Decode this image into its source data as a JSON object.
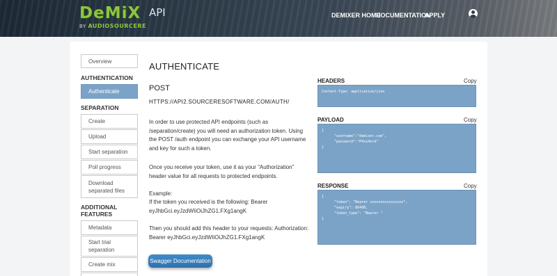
{
  "header": {
    "logo_main": "DeMiX",
    "logo_api": "API",
    "logo_by": "BY",
    "logo_brand": "AUDIOSOURCERE",
    "nav": [
      "DEMIXER HOME",
      "DOCUMENTATION",
      "APPLY"
    ]
  },
  "sidebar": {
    "overview": "Overview",
    "sections": [
      {
        "title": "AUTHENTICATION",
        "items": [
          "Authenticate"
        ]
      },
      {
        "title": "SEPARATION",
        "items": [
          "Create",
          "Upload",
          "Start separation",
          "Poll progress",
          "Download separated files"
        ]
      },
      {
        "title": "ADDITIONAL FEATURES",
        "items": [
          "Metadata",
          "Start trial separation",
          "Create mix"
        ]
      }
    ],
    "active_item": "Authenticate"
  },
  "main": {
    "title": "AUTHENTICATE",
    "method": "POST",
    "endpoint": "HTTPS://API2.SOURCERESOFTWARE.COM/AUTH/",
    "paragraphs": [
      "In order to use protected API endpoints (such as /separation/create) you will need an authorization token. Using the POST /auth endpoint you can exchange your API username and key for such a token.",
      "Once you receive your token, use it as your \"Authorization\" header value for all requests to protected endpoints.",
      "Example:",
      "If the token you received is the following: Bearer eyJhbGci.eyJzdWIiOiJhZG1.FXg1angK",
      "Then you should add this header to your requests: Authorization: Bearer eyJhbGci.eyJzdWIiOiJhZG1.FXg1angK"
    ],
    "swagger_button": "Swagger Documentation"
  },
  "panels": {
    "copy_label": "Copy",
    "headers": {
      "title": "HEADERS",
      "lines": [
        "Content-Type: application/json"
      ]
    },
    "payload": {
      "title": "PAYLOAD",
      "lines": [
        "{",
        "",
        "      \"username\":\"demixer.com\",",
        "",
        "      \"password\":\"P4ss4ord\"",
        "",
        "}"
      ]
    },
    "response": {
      "title": "RESPONSE",
      "lines": [
        "{",
        "",
        "      \"token\": \"Bearer xxxxxxxxxxxxxxxx\",",
        "",
        "      \"expiry\": 86400,",
        "",
        "      \"token_type\": \"Bearer \"",
        "",
        "}"
      ]
    }
  },
  "colors": {
    "accent_blue": "#7ba3c8",
    "button_blue": "#3a82c0",
    "logo_green": "#8cc63f"
  }
}
